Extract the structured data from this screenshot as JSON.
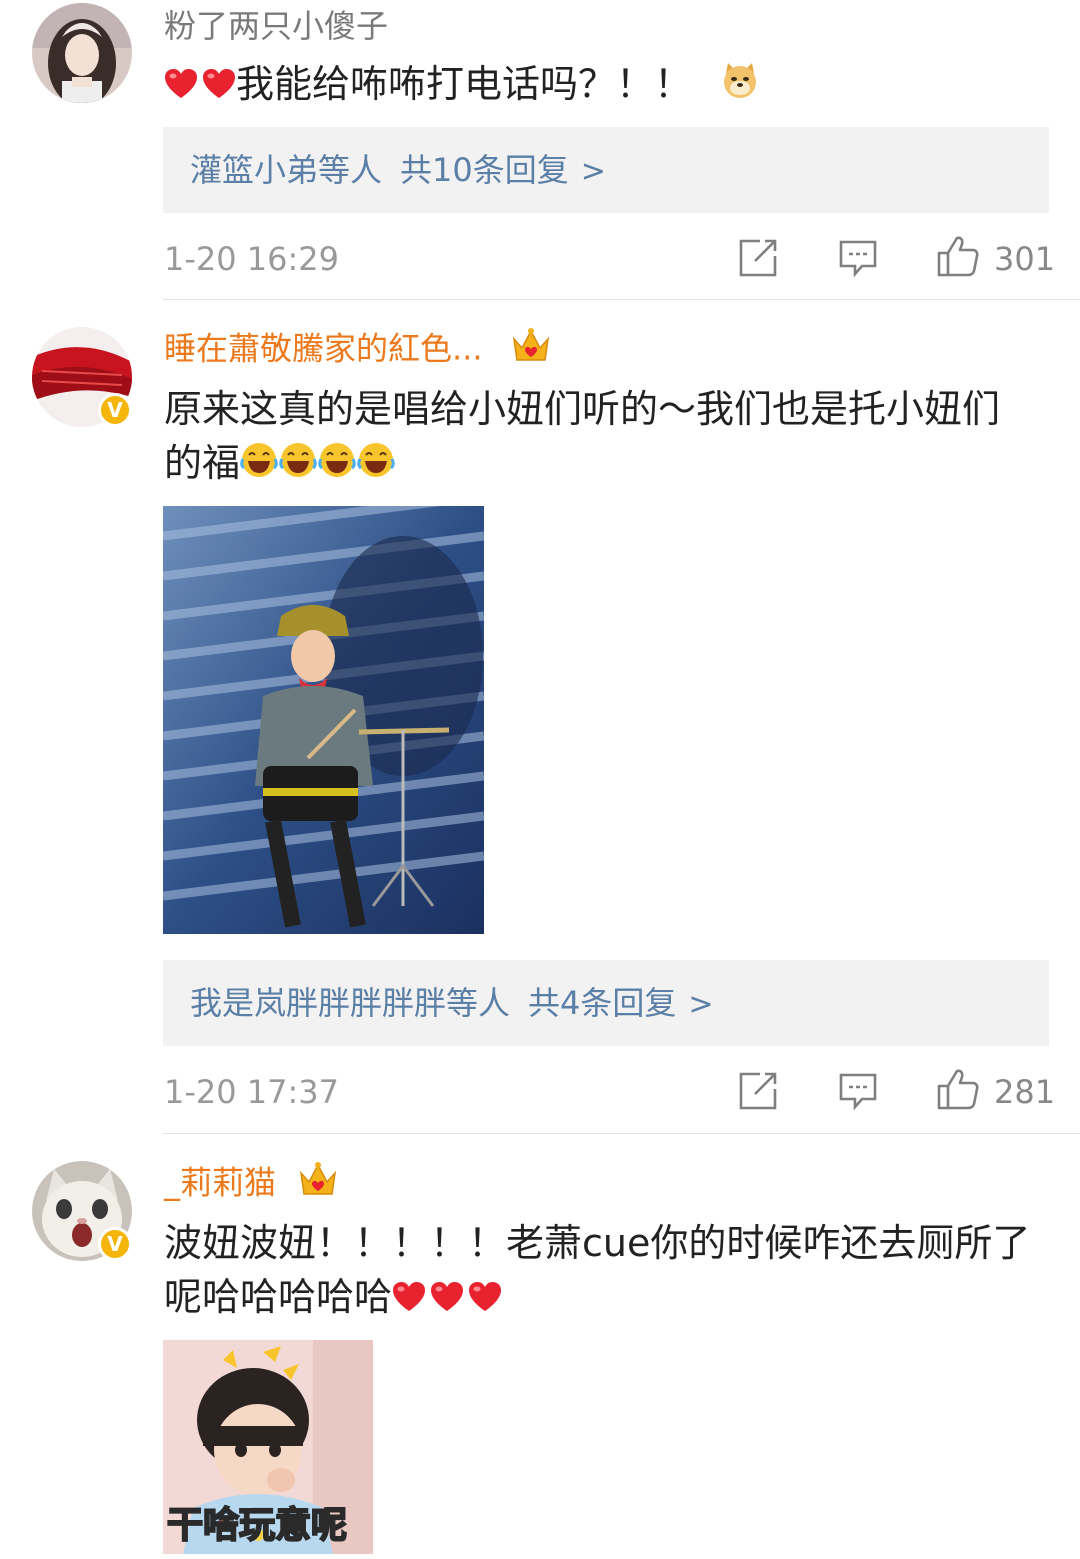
{
  "comments": [
    {
      "username": "粉了两只小傻子",
      "text": "我能给咘咘打电话吗？！！",
      "reply_preview": {
        "users": "灌篮小弟等人",
        "total": "共10条回复",
        "chevron": ">"
      },
      "timestamp": "1-20 16:29",
      "likes": "301"
    },
    {
      "username": "睡在蕭敬騰家的紅色...",
      "text_line1": "原来这真的是唱给小妞们听的～我们也是托小妞们",
      "text_line2": "的福",
      "reply_preview": {
        "users": "我是岚胖胖胖胖胖等人",
        "total": "共4条回复",
        "chevron": ">"
      },
      "timestamp": "1-20 17:37",
      "likes": "281"
    },
    {
      "username": "_莉莉猫",
      "text_line1": "波妞波妞！！！！！老萧cue你的时候咋还去厕所了",
      "text_line2": "呢哈哈哈哈哈",
      "image_caption": "干啥玩意呢"
    }
  ],
  "badges": {
    "verified_symbol": "V"
  },
  "colors": {
    "link": "#5b7fa6",
    "vip_name": "#ec7a1c",
    "plain_name": "#7a7a7a",
    "verified": "#f5b50a",
    "heart": "#e8232f"
  }
}
